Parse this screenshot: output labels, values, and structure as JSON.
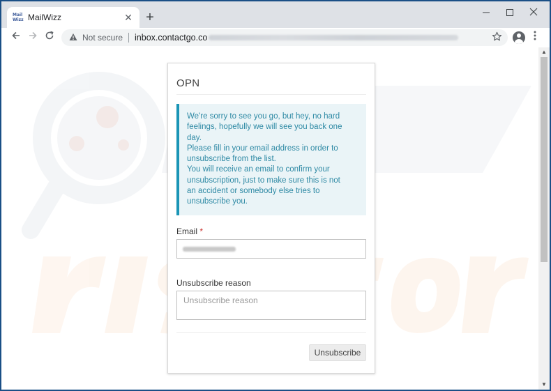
{
  "browser": {
    "tab": {
      "favicon_text": "Mail Wizz",
      "title": "MailWizz"
    },
    "new_tab_glyph": "+",
    "omnibox": {
      "security_label": "Not secure",
      "url_host": "inbox.contactgo.co"
    },
    "icons": [
      "back-arrow-icon",
      "forward-arrow-icon",
      "reload-icon",
      "warning-icon",
      "star-icon",
      "avatar-icon",
      "menu-icon",
      "minimize-icon",
      "maximize-icon",
      "close-icon"
    ]
  },
  "page": {
    "card_title": "OPN",
    "message": "We're sorry to see you go, but hey, no hard\nfeelings, hopefully we will see you back one\nday.\nPlease fill in your email address in order to\nunsubscribe from the list.\nYou will receive an email to confirm your\nunsubscription, just to make sure this is not\nan accident or somebody else tries to\nunsubscribe you.",
    "email_label": "Email",
    "required_mark": "*",
    "reason_label": "Unsubscribe reason",
    "reason_placeholder": "Unsubscribe reason",
    "submit_label": "Unsubscribe"
  },
  "colors": {
    "callout_border": "#1a95b6",
    "callout_bg": "#eaf4f7",
    "callout_text": "#2f8aa5",
    "required": "#c9302c"
  }
}
